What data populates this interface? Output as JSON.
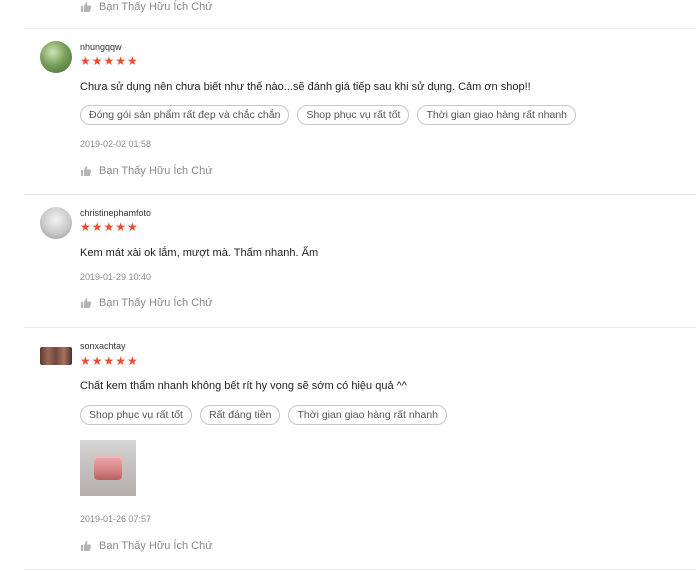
{
  "helpful_label": "Bạn Thấy Hữu Ích Chứ",
  "reviews": [
    {
      "username": "nhungqqw",
      "stars": "★★★★★",
      "comment": "Chưa sử dụng nên chưa biết như thế nào...sẽ đánh giá tiếp sau khi sử dụng. Cảm ơn shop!!",
      "tags": [
        "Đóng gói sản phẩm rất đẹp và chắc chắn",
        "Shop phục vụ rất tốt",
        "Thời gian giao hàng rất nhanh"
      ],
      "timestamp": "2019-02-02 01:58",
      "helpful": "Bạn Thấy Hữu Ích Chứ"
    },
    {
      "username": "christinephamfoto",
      "stars": "★★★★★",
      "comment": "Kem mát xài ok lắm, mượt mà. Thấm nhanh. Ẩm",
      "tags": [],
      "timestamp": "2019-01-29 10:40",
      "helpful": "Bạn Thấy Hữu Ích Chứ"
    },
    {
      "username": "sonxachtay",
      "stars": "★★★★★",
      "comment": "Chất kem thẩm nhanh không bết rít hy vọng sẽ sớm có hiệu quả ^^",
      "tags": [
        "Shop phục vụ rất tốt",
        "Rất đáng tiền",
        "Thời gian giao hàng rất nhanh"
      ],
      "timestamp": "2019-01-26 07:57",
      "helpful": "Bạn Thấy Hữu Ích Chứ"
    }
  ],
  "colors": {
    "star": "#ee4d2d",
    "muted_text": "#8a8a8a",
    "divider": "#ececec",
    "tag_border": "#c8c8c8"
  },
  "icons": {
    "thumb": "thumbs-up-icon"
  }
}
